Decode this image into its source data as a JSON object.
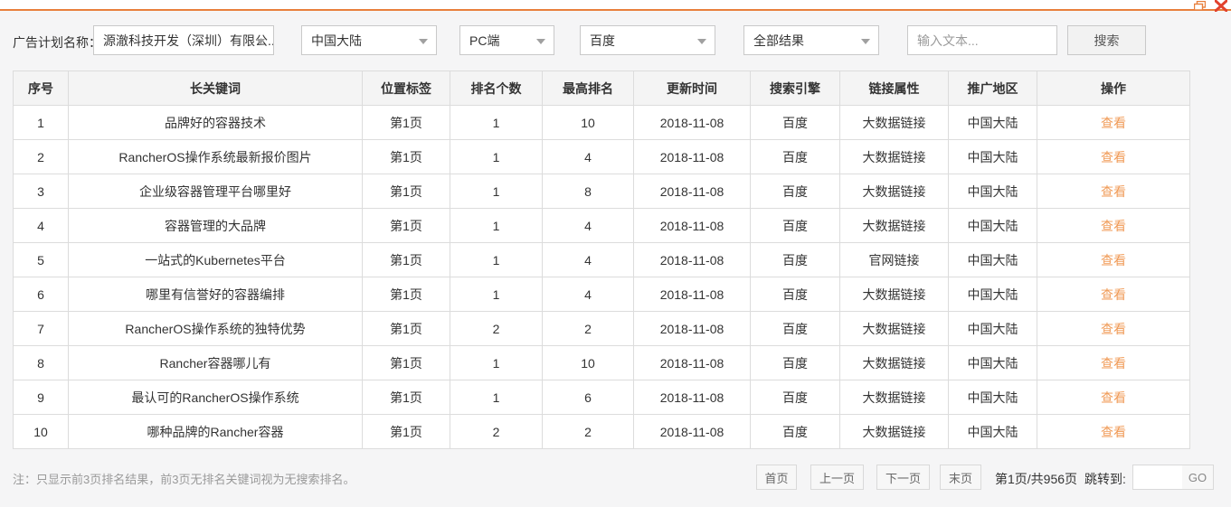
{
  "window": {
    "restore_icon": "restore-window",
    "close_icon": "close-window"
  },
  "filters": {
    "label": "广告计划名称：",
    "plan": "源澈科技开发（深圳）有限公...",
    "region": "中国大陆",
    "device": "PC端",
    "engine": "百度",
    "result": "全部结果",
    "search_placeholder": "输入文本...",
    "search_button": "搜索"
  },
  "table": {
    "columns": [
      "序号",
      "长关键词",
      "位置标签",
      "排名个数",
      "最高排名",
      "更新时间",
      "搜索引擎",
      "链接属性",
      "推广地区",
      "操作"
    ],
    "action_label": "查看",
    "rows": [
      [
        "1",
        "品牌好的容器技术",
        "第1页",
        "1",
        "10",
        "2018-11-08",
        "百度",
        "大数据链接",
        "中国大陆"
      ],
      [
        "2",
        "RancherOS操作系统最新报价图片",
        "第1页",
        "1",
        "4",
        "2018-11-08",
        "百度",
        "大数据链接",
        "中国大陆"
      ],
      [
        "3",
        "企业级容器管理平台哪里好",
        "第1页",
        "1",
        "8",
        "2018-11-08",
        "百度",
        "大数据链接",
        "中国大陆"
      ],
      [
        "4",
        "容器管理的大品牌",
        "第1页",
        "1",
        "4",
        "2018-11-08",
        "百度",
        "大数据链接",
        "中国大陆"
      ],
      [
        "5",
        "一站式的Kubernetes平台",
        "第1页",
        "1",
        "4",
        "2018-11-08",
        "百度",
        "官网链接",
        "中国大陆"
      ],
      [
        "6",
        "哪里有信誉好的容器编排",
        "第1页",
        "1",
        "4",
        "2018-11-08",
        "百度",
        "大数据链接",
        "中国大陆"
      ],
      [
        "7",
        "RancherOS操作系统的独特优势",
        "第1页",
        "2",
        "2",
        "2018-11-08",
        "百度",
        "大数据链接",
        "中国大陆"
      ],
      [
        "8",
        "Rancher容器哪儿有",
        "第1页",
        "1",
        "10",
        "2018-11-08",
        "百度",
        "大数据链接",
        "中国大陆"
      ],
      [
        "9",
        "最认可的RancherOS操作系统",
        "第1页",
        "1",
        "6",
        "2018-11-08",
        "百度",
        "大数据链接",
        "中国大陆"
      ],
      [
        "10",
        "哪种品牌的Rancher容器",
        "第1页",
        "2",
        "2",
        "2018-11-08",
        "百度",
        "大数据链接",
        "中国大陆"
      ]
    ]
  },
  "footer": {
    "note": "注：只显示前3页排名结果，前3页无排名关键词视为无搜索排名。",
    "pagination": {
      "first": "首页",
      "prev": "上一页",
      "next": "下一页",
      "last": "末页",
      "page_info": "第1页/共956页",
      "jump_label": "跳转到:",
      "go_button": "GO"
    }
  },
  "colors": {
    "accent": "#e87f3c",
    "link": "#f09a56",
    "close": "#e2422d"
  }
}
